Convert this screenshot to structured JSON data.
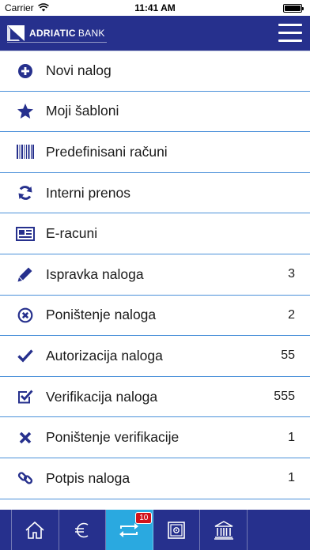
{
  "status_bar": {
    "carrier": "Carrier",
    "time": "11:41 AM"
  },
  "header": {
    "brand_name_strong": "ADRIATIC",
    "brand_name_light": "BANK",
    "menu_icon": "hamburger-menu-icon"
  },
  "menu": [
    {
      "label": "Novi nalog",
      "icon": "plus-circle-icon",
      "count": ""
    },
    {
      "label": "Moji šabloni",
      "icon": "star-icon",
      "count": ""
    },
    {
      "label": "Predefinisani računi",
      "icon": "barcode-icon",
      "count": ""
    },
    {
      "label": "Interni prenos",
      "icon": "refresh-icon",
      "count": ""
    },
    {
      "label": "E-racuni",
      "icon": "newspaper-icon",
      "count": ""
    },
    {
      "label": "Ispravka naloga",
      "icon": "pencil-icon",
      "count": "3"
    },
    {
      "label": "Poništenje naloga",
      "icon": "x-circle-icon",
      "count": "2"
    },
    {
      "label": "Autorizacija naloga",
      "icon": "checkmark-icon",
      "count": "55"
    },
    {
      "label": "Verifikacija naloga",
      "icon": "checkbox-icon",
      "count": "555"
    },
    {
      "label": "Poništenje verifikacije",
      "icon": "x-mark-icon",
      "count": "1"
    },
    {
      "label": "Potpis naloga",
      "icon": "link-icon",
      "count": "1"
    }
  ],
  "tab_bar": {
    "active_tab": "transfers",
    "badge": "10",
    "tabs": [
      {
        "id": "home",
        "icon": "home-icon"
      },
      {
        "id": "currency",
        "icon": "euro-icon"
      },
      {
        "id": "transfers",
        "icon": "transfer-arrows-icon"
      },
      {
        "id": "safe",
        "icon": "safe-icon"
      },
      {
        "id": "bank",
        "icon": "bank-building-icon"
      }
    ]
  },
  "colors": {
    "brand_blue": "#26308d",
    "active_tab": "#2aa9e0",
    "separator": "#4a90d9",
    "badge_red": "#d0121b"
  }
}
